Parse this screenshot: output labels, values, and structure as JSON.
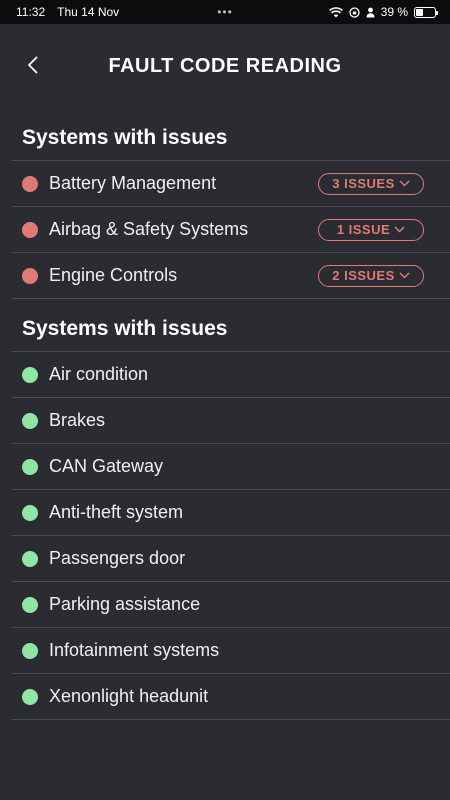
{
  "status_bar": {
    "time": "11:32",
    "date": "Thu 14 Nov",
    "dots": "•••",
    "battery": "39 %",
    "battery_level": 0.39
  },
  "header": {
    "title": "FAULT CODE READING"
  },
  "colors": {
    "background": "#2a2c32",
    "issue_red": "#e07a74",
    "ok_green": "#8fe6a2"
  },
  "sections": [
    {
      "title": "Systems with issues",
      "status": "issue",
      "items": [
        {
          "label": "Battery Management",
          "badge": "3 ISSUES"
        },
        {
          "label": "Airbag & Safety Systems",
          "badge": "1 ISSUE"
        },
        {
          "label": "Engine Controls",
          "badge": "2 ISSUES"
        }
      ]
    },
    {
      "title": "Systems with issues",
      "status": "ok",
      "items": [
        {
          "label": "Air condition"
        },
        {
          "label": "Brakes"
        },
        {
          "label": "CAN Gateway"
        },
        {
          "label": "Anti-theft system"
        },
        {
          "label": "Passengers door"
        },
        {
          "label": "Parking assistance"
        },
        {
          "label": "Infotainment systems"
        },
        {
          "label": "Xenonlight headunit"
        }
      ]
    }
  ]
}
